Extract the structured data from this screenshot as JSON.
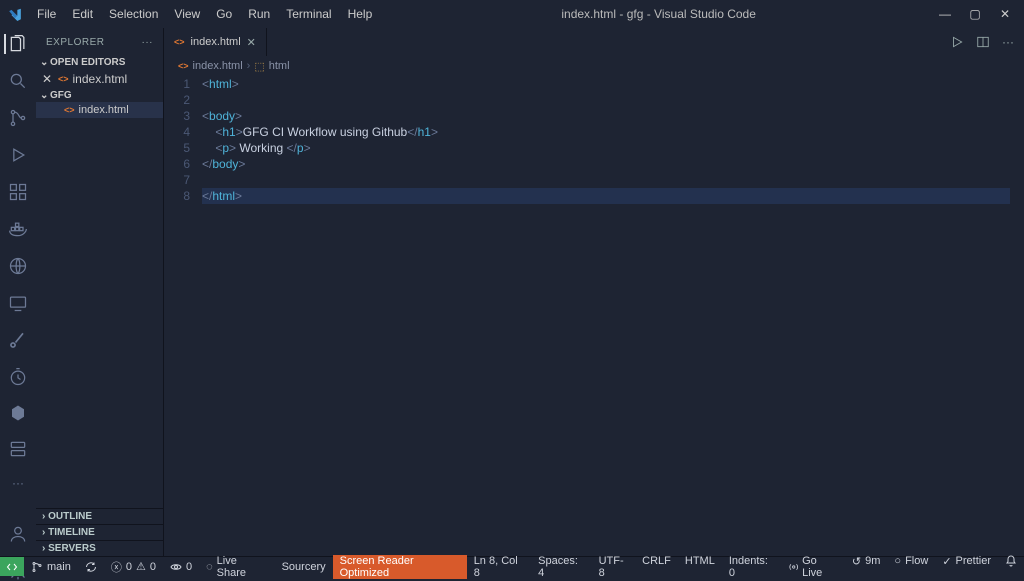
{
  "window": {
    "title": "index.html - gfg - Visual Studio Code"
  },
  "menu": [
    "File",
    "Edit",
    "Selection",
    "View",
    "Go",
    "Run",
    "Terminal",
    "Help"
  ],
  "explorer": {
    "title": "EXPLORER",
    "open_editors_label": "OPEN EDITORS",
    "open_editors": [
      {
        "name": "index.html",
        "dirty": false
      }
    ],
    "folder_label": "GFG",
    "files": [
      {
        "name": "index.html",
        "selected": true
      }
    ],
    "bottom_sections": [
      "OUTLINE",
      "TIMELINE",
      "SERVERS"
    ]
  },
  "tabs": {
    "items": [
      {
        "name": "index.html",
        "active": true
      }
    ]
  },
  "breadcrumbs": {
    "file": "index.html",
    "symbol": "html"
  },
  "code_lines": [
    {
      "n": 1,
      "seg": [
        [
          "<",
          "b"
        ],
        [
          "html",
          "t"
        ],
        [
          ">",
          "b"
        ]
      ]
    },
    {
      "n": 2,
      "seg": []
    },
    {
      "n": 3,
      "seg": [
        [
          "<",
          "b"
        ],
        [
          "body",
          "t"
        ],
        [
          ">",
          "b"
        ]
      ]
    },
    {
      "n": 4,
      "seg": [
        [
          "    ",
          ""
        ],
        [
          "<",
          "b"
        ],
        [
          "h1",
          "t"
        ],
        [
          ">",
          "b"
        ],
        [
          "GFG CI Workflow using Github",
          "x"
        ],
        [
          "</",
          "b"
        ],
        [
          "h1",
          "t"
        ],
        [
          ">",
          "b"
        ]
      ]
    },
    {
      "n": 5,
      "seg": [
        [
          "    ",
          ""
        ],
        [
          "<",
          "b"
        ],
        [
          "p",
          "t"
        ],
        [
          ">",
          "b"
        ],
        [
          " Working ",
          "x"
        ],
        [
          "</",
          "b"
        ],
        [
          "p",
          "t"
        ],
        [
          ">",
          "b"
        ]
      ]
    },
    {
      "n": 6,
      "seg": [
        [
          "</",
          "b"
        ],
        [
          "body",
          "t"
        ],
        [
          ">",
          "b"
        ]
      ]
    },
    {
      "n": 7,
      "seg": []
    },
    {
      "n": 8,
      "seg": [
        [
          "</",
          "b"
        ],
        [
          "html",
          "t"
        ],
        [
          ">",
          "b"
        ]
      ],
      "hl": true
    }
  ],
  "status": {
    "branch": "main",
    "errors": "0",
    "warnings": "0",
    "ports": "0",
    "live_share": "Live Share",
    "sourcery": "Sourcery",
    "screen_reader": "Screen Reader Optimized",
    "cursor": "Ln 8, Col 8",
    "spaces": "Spaces: 4",
    "encoding": "UTF-8",
    "eol": "CRLF",
    "lang": "HTML",
    "indents": "Indents: 0",
    "golive": "Go Live",
    "time": "9m",
    "flow": "Flow",
    "prettier": "Prettier"
  }
}
